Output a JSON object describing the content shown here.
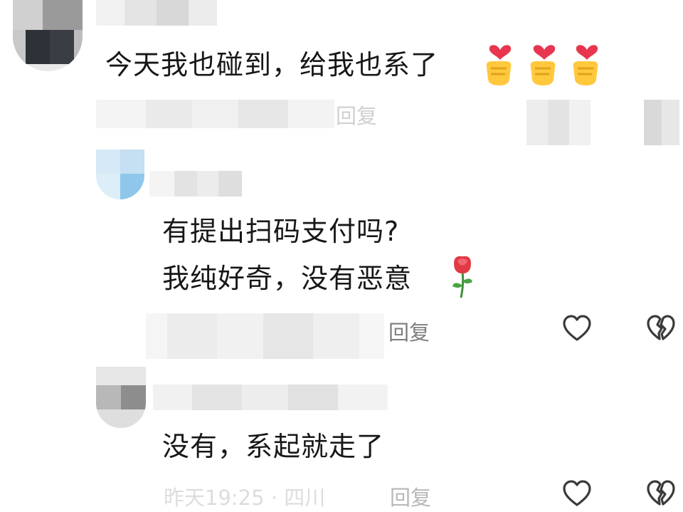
{
  "comments": [
    {
      "text": "今天我也碰到，给我也系了",
      "reply_label": "回复",
      "emoji_icons": [
        "finger-heart-icon",
        "finger-heart-icon",
        "finger-heart-icon"
      ]
    },
    {
      "lines": [
        "有提出扫码支付吗?",
        "我纯好奇，没有恶意"
      ],
      "reply_label": "回复",
      "trailing_emoji": "rose-icon"
    },
    {
      "text": "没有，系起就走了",
      "meta": "昨天19:25 · 四川",
      "reply_label": "回复"
    }
  ],
  "actions": {
    "like_icon": "heart-outline-icon",
    "dislike_icon": "broken-heart-icon"
  },
  "colors": {
    "text": "#171717",
    "muted": "#7d7d7d",
    "icon_stroke": "#3a3a3a",
    "heart_red": "#e8364f",
    "emoji_yellow": "#ffc83d"
  }
}
